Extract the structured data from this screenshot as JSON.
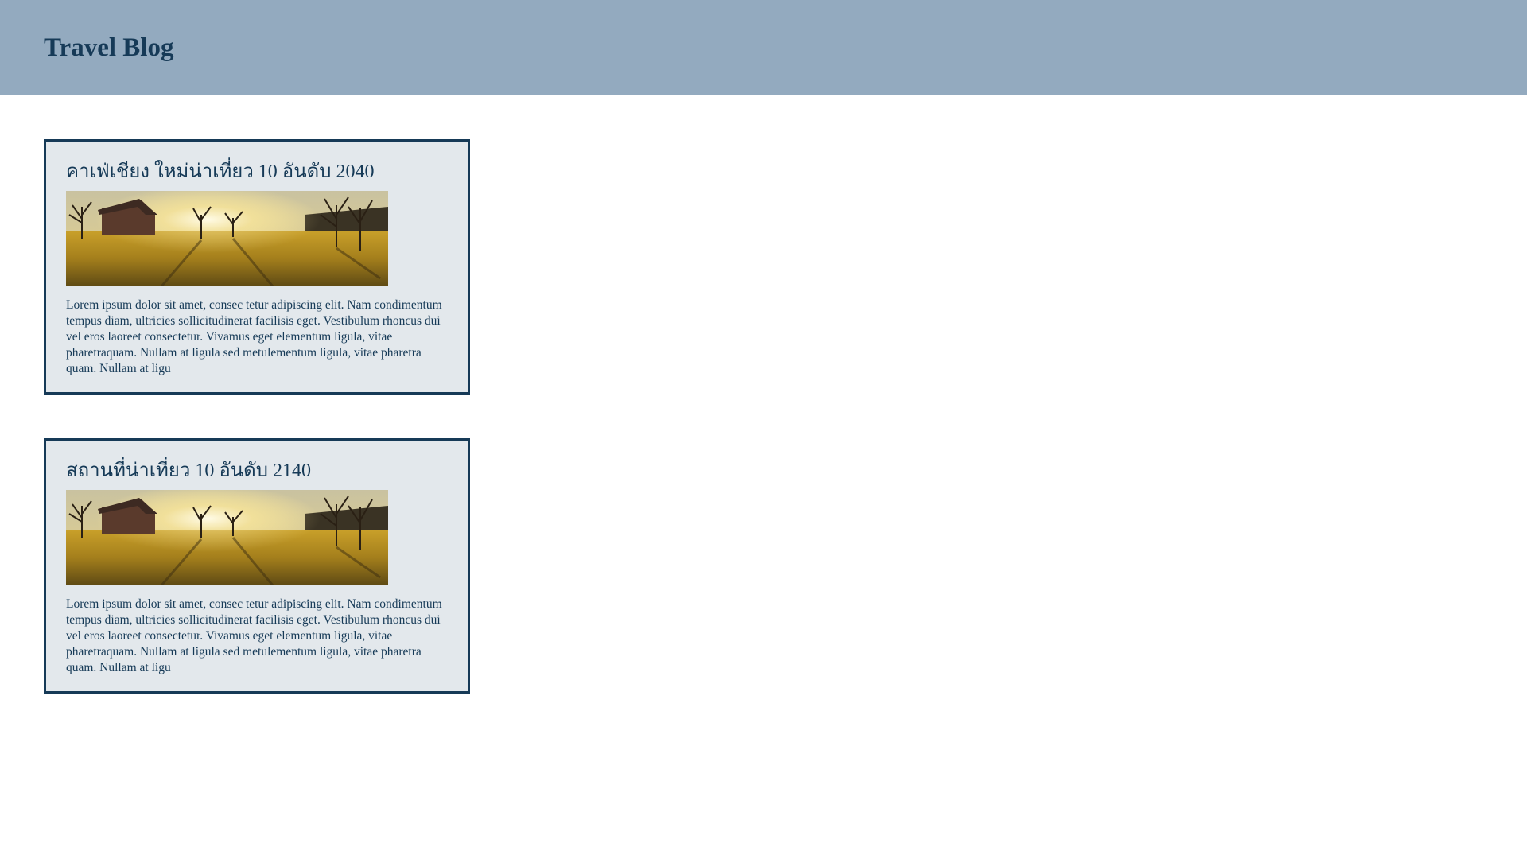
{
  "header": {
    "title": "Travel Blog",
    "background": "#93aabf",
    "text_color": "#163a57"
  },
  "posts": [
    {
      "title": "คาเฟ่เชียง ใหม่น่าเที่ยว 10 อันดับ 2040",
      "image_icon": "landscape-photo",
      "body": "Lorem ipsum dolor sit amet, consec tetur adipiscing elit. Nam condimentum tempus diam, ultricies sollicitudinerat facilisis eget. Vestibulum rhoncus dui vel eros laoreet consectetur. Vivamus eget elementum ligula, vitae pharetraquam. Nullam at ligula sed metulementum ligula, vitae pharetra quam. Nullam at ligu"
    },
    {
      "title": "สถานที่น่าเที่ยว 10 อันดับ 2140",
      "image_icon": "landscape-photo",
      "body": "Lorem ipsum dolor sit amet, consec tetur adipiscing elit. Nam condimentum tempus diam, ultricies sollicitudinerat facilisis eget. Vestibulum rhoncus dui vel eros laoreet consectetur. Vivamus eget elementum ligula, vitae pharetraquam. Nullam at ligula sed metulementum ligula, vitae pharetra quam. Nullam at ligu"
    }
  ],
  "colors": {
    "card_background": "#e3e8ec",
    "card_border": "#163a57"
  }
}
